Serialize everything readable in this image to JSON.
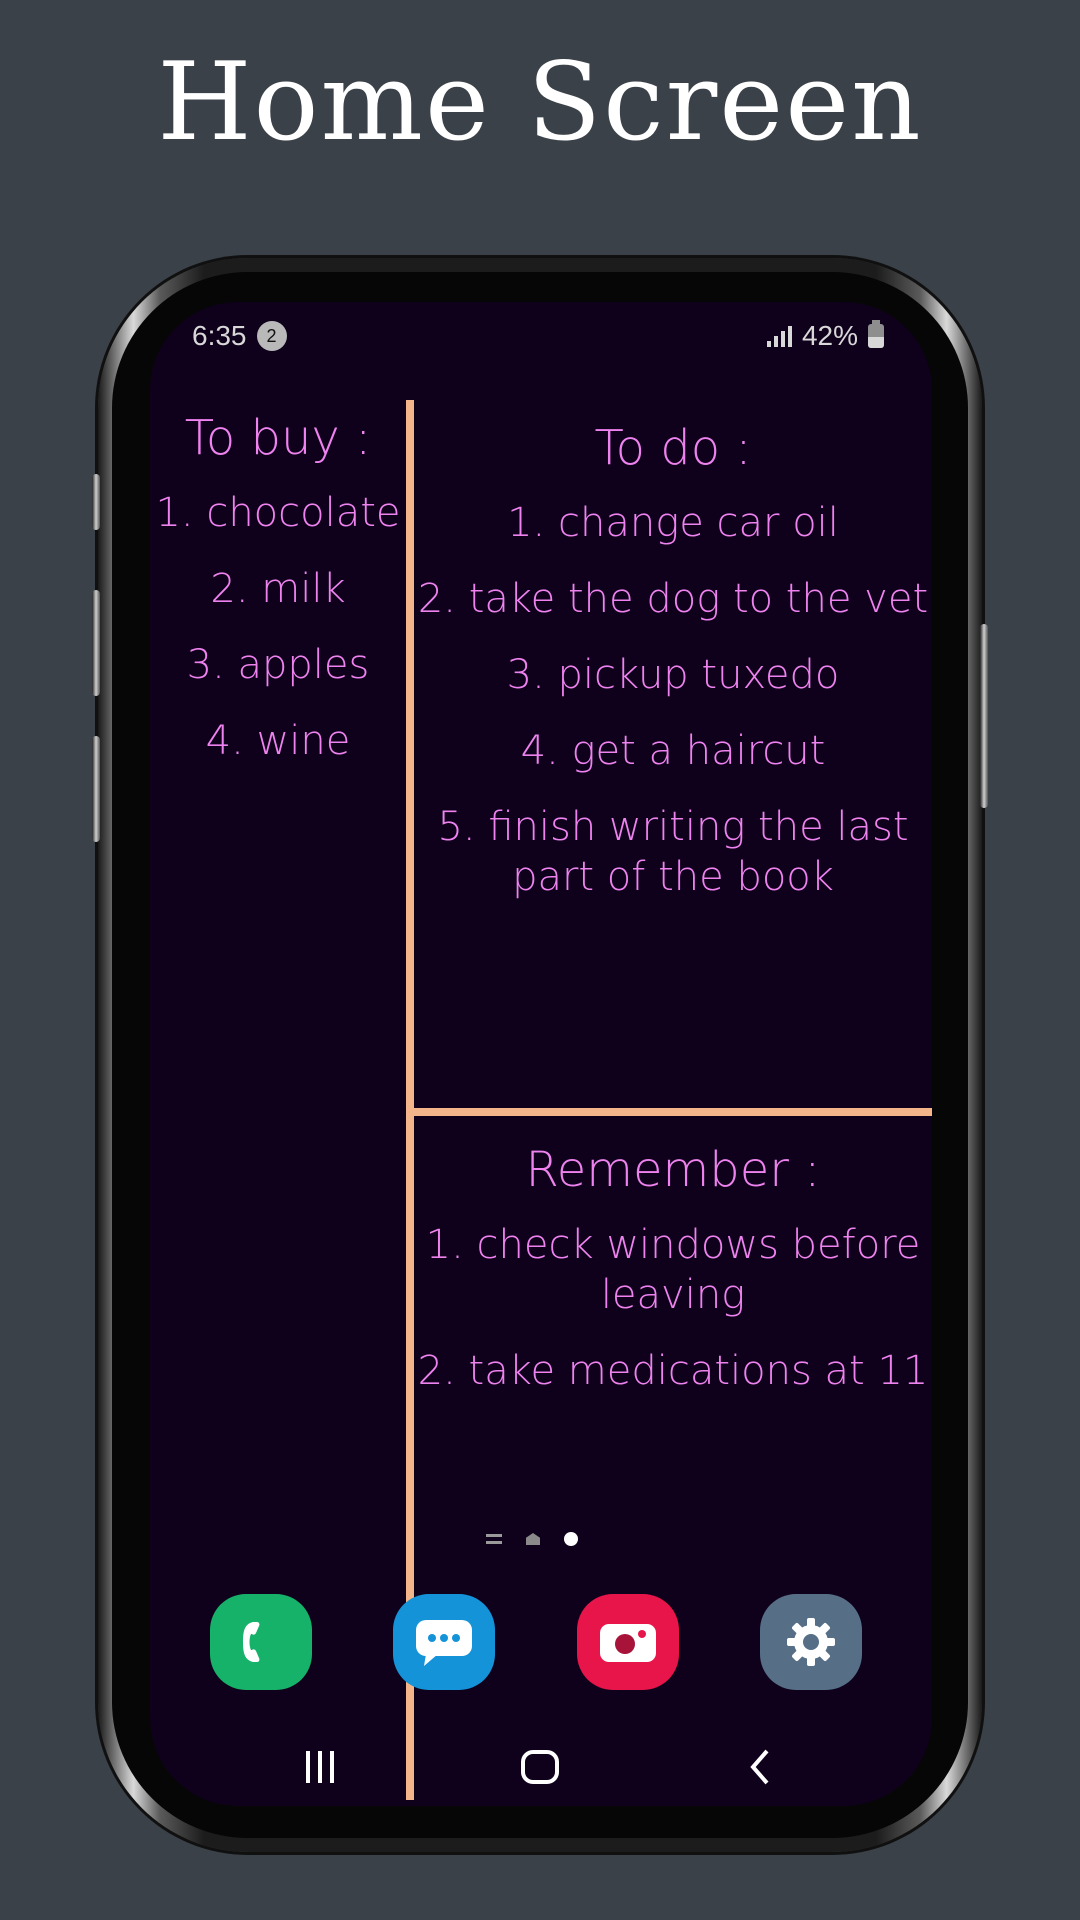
{
  "title": "Home Screen",
  "status_bar": {
    "time": "6:35",
    "notification_count": "2",
    "battery": "42%"
  },
  "notes": {
    "to_buy": {
      "heading": "To buy :",
      "items": [
        "1. chocolate",
        "2. milk",
        "3. apples",
        "4. wine"
      ]
    },
    "to_do": {
      "heading": "To do :",
      "items": [
        "1. change car oil",
        "2. take the dog to the vet",
        "3. pickup tuxedo",
        "4. get a haircut",
        "5. finish writing the last part of the book"
      ]
    },
    "remember": {
      "heading": "Remember :",
      "items": [
        "1. check windows before leaving",
        "2. take medications at 11"
      ]
    }
  },
  "dock": [
    {
      "name": "phone",
      "icon": "phone-icon",
      "color": "#17b26a"
    },
    {
      "name": "messages",
      "icon": "messages-icon",
      "color": "#1593d8"
    },
    {
      "name": "camera",
      "icon": "camera-icon",
      "color": "#e8154a"
    },
    {
      "name": "settings",
      "icon": "gear-icon",
      "color": "#566f86"
    }
  ],
  "colors": {
    "background": "#3a4148",
    "screen": "#0f011c",
    "note_text": "#ee82ee",
    "divider": "#f5b58a"
  }
}
